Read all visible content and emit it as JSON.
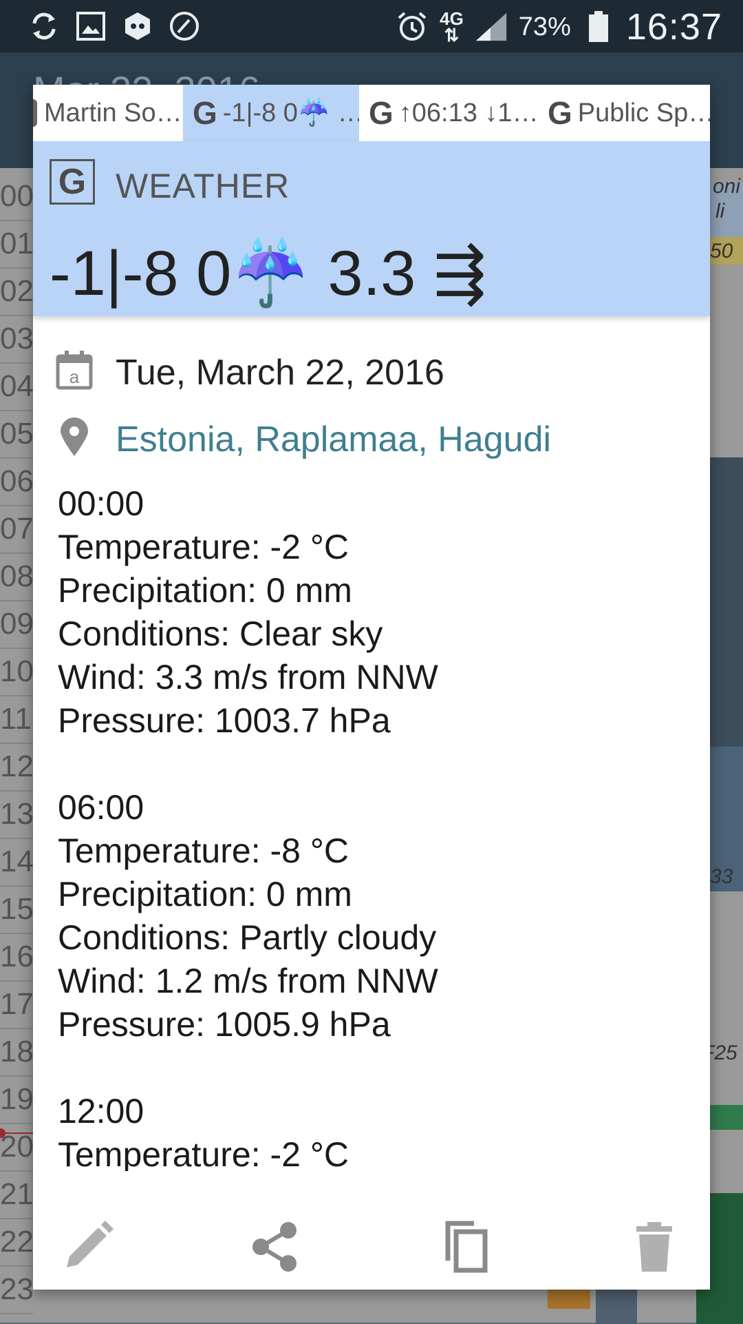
{
  "status_bar": {
    "left_icons": [
      "sync-icon",
      "image-icon",
      "vpn-shield-icon",
      "speedometer-icon"
    ],
    "network": "4G",
    "battery_percent": "73%",
    "time": "16:37"
  },
  "background": {
    "app_title": "Mar 22, 2016",
    "hour_labels": [
      "00",
      "01",
      "02",
      "03",
      "04",
      "05",
      "06",
      "07",
      "08",
      "09",
      "10",
      "11",
      "12",
      "13",
      "14",
      "15",
      "16",
      "17",
      "18",
      "19",
      "20",
      "21",
      "22",
      "23"
    ],
    "event_snippets": [
      "oni",
      "li",
      "50",
      "33",
      "F25"
    ]
  },
  "dialog": {
    "tabs": [
      {
        "label": "Martin So…",
        "icon": "person-icon",
        "active": false
      },
      {
        "label": "-1|-8 0☔ …",
        "icon": "google-g-icon",
        "active": true
      },
      {
        "label": "↑06:13 ↓1…",
        "icon": "google-g-icon",
        "active": false
      },
      {
        "label": "Public Sp…",
        "icon": "google-g-icon",
        "active": false
      }
    ],
    "header": {
      "type_label": "WEATHER",
      "summary": "-1|-8 0☔ 3.3 ⇶"
    },
    "date": "Tue, March 22, 2016",
    "location": "Estonia, Raplamaa, Hagudi",
    "forecast": [
      {
        "time": "00:00",
        "temperature": "Temperature: -2 °C",
        "precipitation": "Precipitation: 0 mm",
        "conditions": "Conditions: Clear sky",
        "wind": "Wind: 3.3 m/s from NNW",
        "pressure": "Pressure: 1003.7 hPa"
      },
      {
        "time": "06:00",
        "temperature": "Temperature: -8 °C",
        "precipitation": "Precipitation: 0 mm",
        "conditions": "Conditions: Partly cloudy",
        "wind": "Wind: 1.2 m/s from NNW",
        "pressure": "Pressure: 1005.9 hPa"
      },
      {
        "time": "12:00",
        "temperature": "Temperature: -2 °C"
      }
    ],
    "actions": [
      "edit-icon",
      "share-icon",
      "copy-icon",
      "delete-icon"
    ],
    "colors": {
      "header_bg": "#b9d4f7",
      "link": "#3f7f90",
      "icon_gray": "#8a8a8a"
    }
  }
}
